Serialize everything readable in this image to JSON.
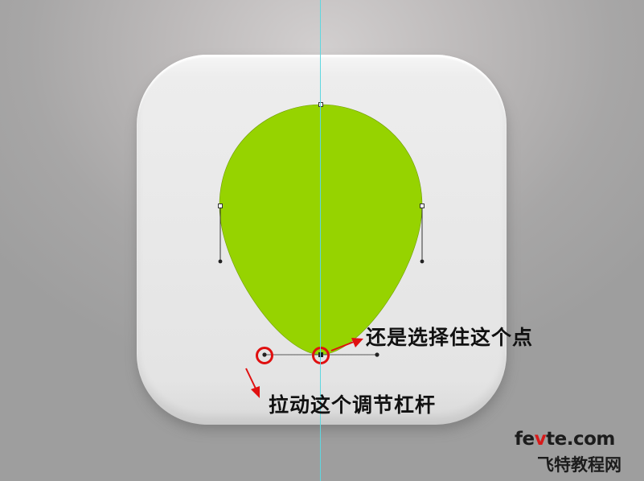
{
  "annotations": {
    "select_point": "还是选择住这个点",
    "drag_handle": "拉动这个调节杠杆"
  },
  "watermark": {
    "site_prefix": "fe",
    "site_accent": "v",
    "site_suffix": "te.com",
    "site_name": "飞特教程网"
  },
  "colors": {
    "shape_fill": "#96d300",
    "guide_line": "#5fd7e0",
    "highlight_circle": "#e01010",
    "arrow": "#e01010",
    "watermark_accent": "#d81a1a"
  }
}
